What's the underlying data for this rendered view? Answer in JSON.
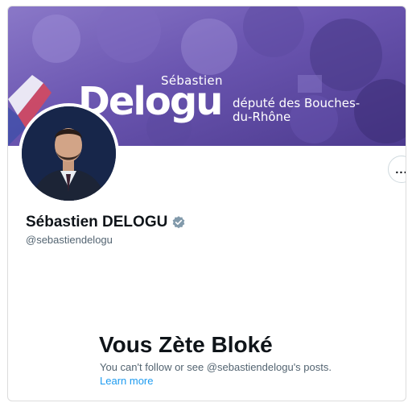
{
  "banner": {
    "first_name": "Sébastien",
    "last_name": "Delogu",
    "role": "député des Bouches-du-Rhône"
  },
  "profile": {
    "display_name": "Sébastien DELOGU",
    "handle": "@sebastiendelogu",
    "verified_icon": "verified-badge-icon"
  },
  "actions": {
    "more_label": "..."
  },
  "blocked": {
    "title": "Vous Zète Bloké",
    "message": "You can't follow or see @sebastiendelogu's posts.",
    "link": "Learn more"
  },
  "colors": {
    "banner": "#6a55b0",
    "link": "#1d9bf0",
    "secondary_text": "#536471",
    "primary_text": "#0f1419"
  }
}
